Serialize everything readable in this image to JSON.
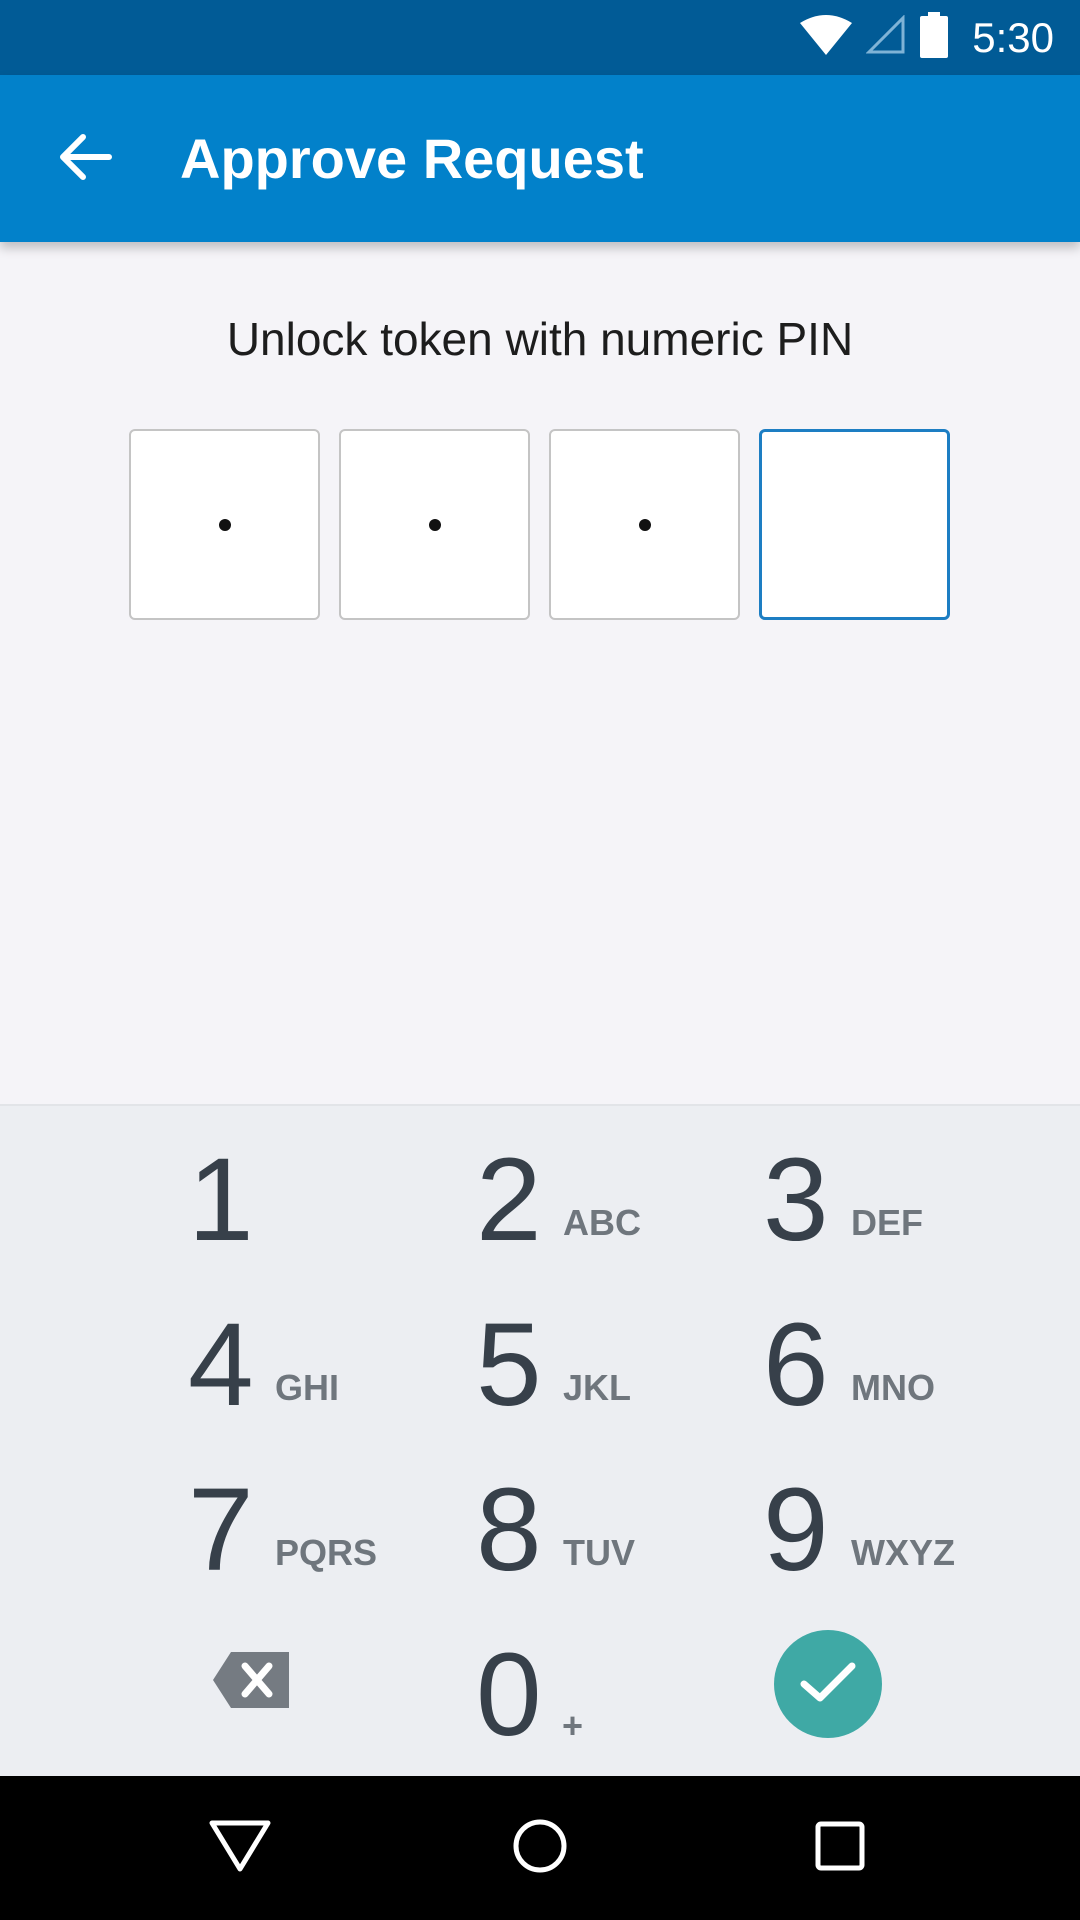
{
  "status_bar": {
    "time": "5:30"
  },
  "app_bar": {
    "title": "Approve Request"
  },
  "pin": {
    "prompt": "Unlock token with numeric PIN",
    "length": 4,
    "entered_count": 3
  },
  "keypad": {
    "keys": [
      {
        "digit": "1",
        "letters": ""
      },
      {
        "digit": "2",
        "letters": "ABC"
      },
      {
        "digit": "3",
        "letters": "DEF"
      },
      {
        "digit": "4",
        "letters": "GHI"
      },
      {
        "digit": "5",
        "letters": "JKL"
      },
      {
        "digit": "6",
        "letters": "MNO"
      },
      {
        "digit": "7",
        "letters": "PQRS"
      },
      {
        "digit": "8",
        "letters": "TUV"
      },
      {
        "digit": "9",
        "letters": "WXYZ"
      },
      {
        "digit": "0",
        "letters": "+"
      }
    ]
  },
  "icons": {
    "wifi": "wifi-icon",
    "signal": "cellular-signal-icon",
    "battery": "battery-icon",
    "back": "arrow-back-icon",
    "backspace": "backspace-icon",
    "confirm": "check-icon",
    "nav_back": "nav-back-icon",
    "nav_home": "nav-home-icon",
    "nav_recents": "nav-recents-icon"
  },
  "colors": {
    "status_bar": "#015b96",
    "app_bar": "#0281ca",
    "active_pin_border": "#1d7ec3",
    "confirm": "#3fa9a5"
  }
}
